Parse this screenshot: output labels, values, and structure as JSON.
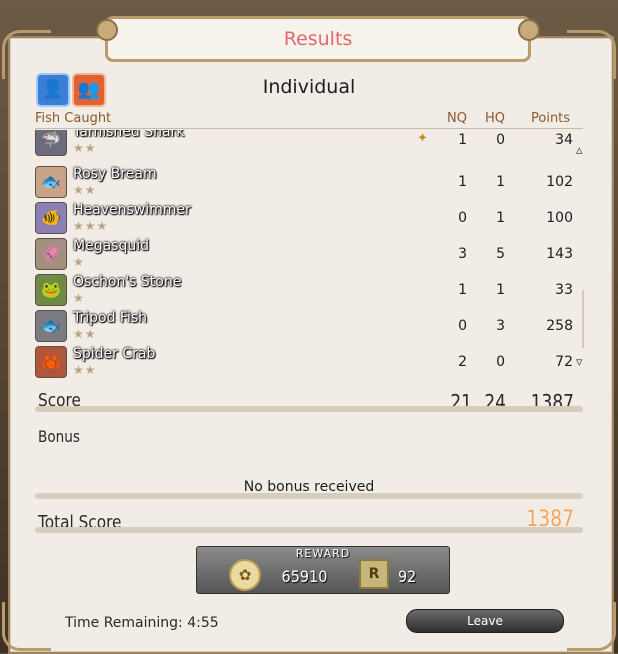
{
  "window": {
    "title": "Results"
  },
  "tabs": {
    "individual_icon": "person-icon",
    "party_icon": "party-icon"
  },
  "heading": "Individual",
  "columns": {
    "fish": "Fish Caught",
    "nq": "NQ",
    "hq": "HQ",
    "points": "Points"
  },
  "fish": [
    {
      "name": "Tarnished Shark",
      "stars": "★★",
      "nq": "1",
      "hq": "0",
      "points": "34",
      "icon": "shark-icon",
      "icon_color": "#6c6c7c"
    },
    {
      "name": "Rosy Bream",
      "stars": "★★",
      "nq": "1",
      "hq": "1",
      "points": "102",
      "icon": "bream-icon",
      "icon_color": "#c8a389"
    },
    {
      "name": "Heavenswimmer",
      "stars": "★★★",
      "nq": "0",
      "hq": "1",
      "points": "100",
      "icon": "heavenswimmer-icon",
      "icon_color": "#8b7fb6"
    },
    {
      "name": "Megasquid",
      "stars": "★",
      "nq": "3",
      "hq": "5",
      "points": "143",
      "icon": "squid-icon",
      "icon_color": "#a58f80"
    },
    {
      "name": "Oschon's Stone",
      "stars": "★",
      "nq": "1",
      "hq": "1",
      "points": "33",
      "icon": "stone-icon",
      "icon_color": "#6f8a46"
    },
    {
      "name": "Tripod Fish",
      "stars": "★★",
      "nq": "0",
      "hq": "3",
      "points": "258",
      "icon": "tripod-fish-icon",
      "icon_color": "#7a7a82"
    },
    {
      "name": "Spider Crab",
      "stars": "★★",
      "nq": "2",
      "hq": "0",
      "points": "72",
      "icon": "crab-icon",
      "icon_color": "#b0563a"
    }
  ],
  "score": {
    "label": "Score",
    "nq": "21",
    "hq": "24",
    "points": "1387"
  },
  "bonus": {
    "label": "Bonus",
    "message": "No bonus received"
  },
  "total": {
    "label": "Total Score",
    "value": "1387",
    "color": "#f7a15a"
  },
  "reward": {
    "title": "REWARD",
    "gil": "65910",
    "scrips": "92",
    "scrip_glyph": "R"
  },
  "footer": {
    "timer": "Time Remaining: 4:55",
    "leave_label": "Leave"
  }
}
